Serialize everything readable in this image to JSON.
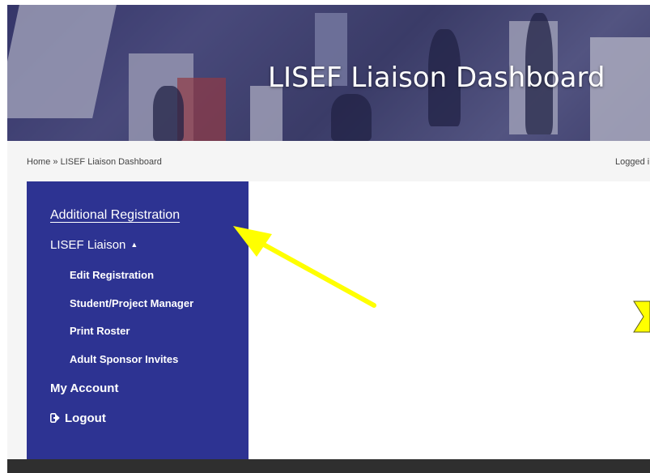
{
  "banner": {
    "title": "LISEF Liaison Dashboard"
  },
  "breadcrumb": {
    "home": "Home",
    "separator": " » ",
    "current": "LISEF Liaison Dashboard"
  },
  "status": {
    "logged_in_text": "Logged i"
  },
  "sidebar": {
    "items": [
      {
        "label": "Additional Registration",
        "active": true
      },
      {
        "label": "LISEF Liaison",
        "expanded": true,
        "caret": "▲",
        "children": [
          {
            "label": "Edit Registration"
          },
          {
            "label": "Student/Project Manager"
          },
          {
            "label": "Print Roster"
          },
          {
            "label": "Adult Sponsor Invites"
          }
        ]
      },
      {
        "label": "My Account"
      },
      {
        "label": "Logout",
        "icon": "sign-out-icon"
      }
    ]
  },
  "colors": {
    "sidebar_bg": "#2d3392",
    "annotation_arrow": "#ffff00",
    "footer_bg": "#2f2f2f"
  }
}
